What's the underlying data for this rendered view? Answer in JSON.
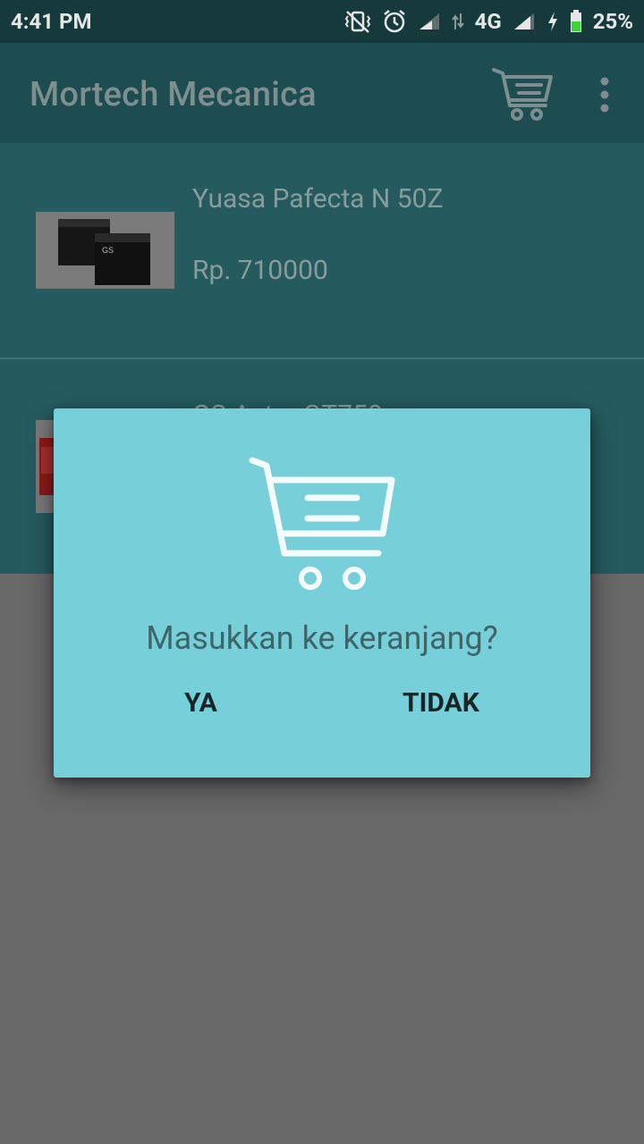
{
  "status_bar": {
    "time": "4:41 PM",
    "network_type": "4G",
    "battery_percent": "25%",
    "icons": [
      "vibrate-off-icon",
      "alarm-icon",
      "signal-icon",
      "data-arrows-icon",
      "signal-icon",
      "charging-icon",
      "battery-icon"
    ]
  },
  "app_bar": {
    "title": "Mortech Mecanica",
    "actions": [
      "cart-icon",
      "overflow-menu-icon"
    ]
  },
  "products": [
    {
      "name": "Yuasa Pafecta N 50Z",
      "price": "Rp. 710000"
    },
    {
      "name": "GS Astra GT750",
      "price": ""
    }
  ],
  "dialog": {
    "icon": "shopping-cart-icon",
    "message": "Masukkan ke keranjang?",
    "confirm_label": "YA",
    "cancel_label": "TIDAK"
  },
  "colors": {
    "status_bar": "#163a3c",
    "app_bar": "#1e4d51",
    "list_background": "#255b5f",
    "dialog_background": "#77cfd9",
    "scrim": "#686868"
  }
}
